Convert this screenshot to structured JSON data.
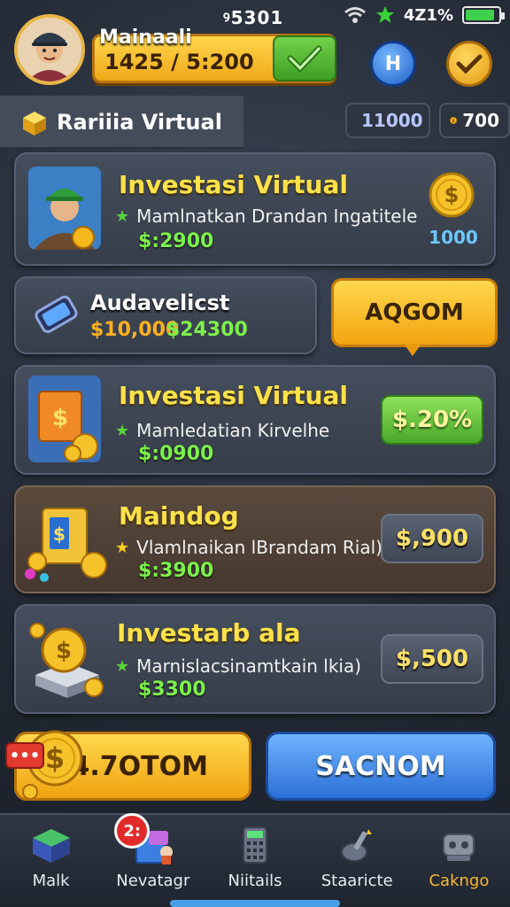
{
  "status": {
    "time": "ꝰ5301",
    "battery_text": "4Z1%",
    "battery_level": 0.9
  },
  "header": {
    "player_name": "Mainaali",
    "balance": "1425 / 5:200"
  },
  "subheader": {
    "title": "Rariiia Virtual",
    "gems": "11000",
    "coins": "700"
  },
  "cards": [
    {
      "title": "Investasi Virtual",
      "subtitle": "Mamlnatkan Drandan Ingatitele",
      "price": "$:2900",
      "side_value": "1000"
    },
    {
      "title": "Audavelicst",
      "price_old": "$10,000",
      "price_new": "$24300",
      "action_label": "AQGOM"
    },
    {
      "title": "Investasi Virtual",
      "subtitle": "Mamledatian Kirvelhe",
      "price": "$:0900",
      "button_label": "$.20%"
    },
    {
      "title": "Maindog",
      "subtitle": "Vlamlnaikan lBrandam Rial)",
      "price": "$:3900",
      "button_label": "$,900"
    },
    {
      "title": "Investarb ala",
      "subtitle": "Marnislacsinamtkain lkia)",
      "price": "$3300",
      "button_label": "$,500"
    }
  ],
  "actions": {
    "primary_label": "4.7OTOM",
    "secondary_label": "SACNOM",
    "chat_glyph": "•••"
  },
  "nav": {
    "badge": "2:",
    "items": [
      {
        "label": "Malk",
        "icon": "package-icon"
      },
      {
        "label": "Nevatagr",
        "icon": "gift-box-icon"
      },
      {
        "label": "Niitails",
        "icon": "calculator-icon"
      },
      {
        "label": "Staaricte",
        "icon": "stats-tool-icon"
      },
      {
        "label": "Cakngo",
        "icon": "settings-device-icon"
      }
    ],
    "active_index": 4
  },
  "colors": {
    "gold": "#ffe14a",
    "green_price": "#7cf04c",
    "accent_orange": "#f7b731",
    "blue_button": "#2c6fd6"
  }
}
